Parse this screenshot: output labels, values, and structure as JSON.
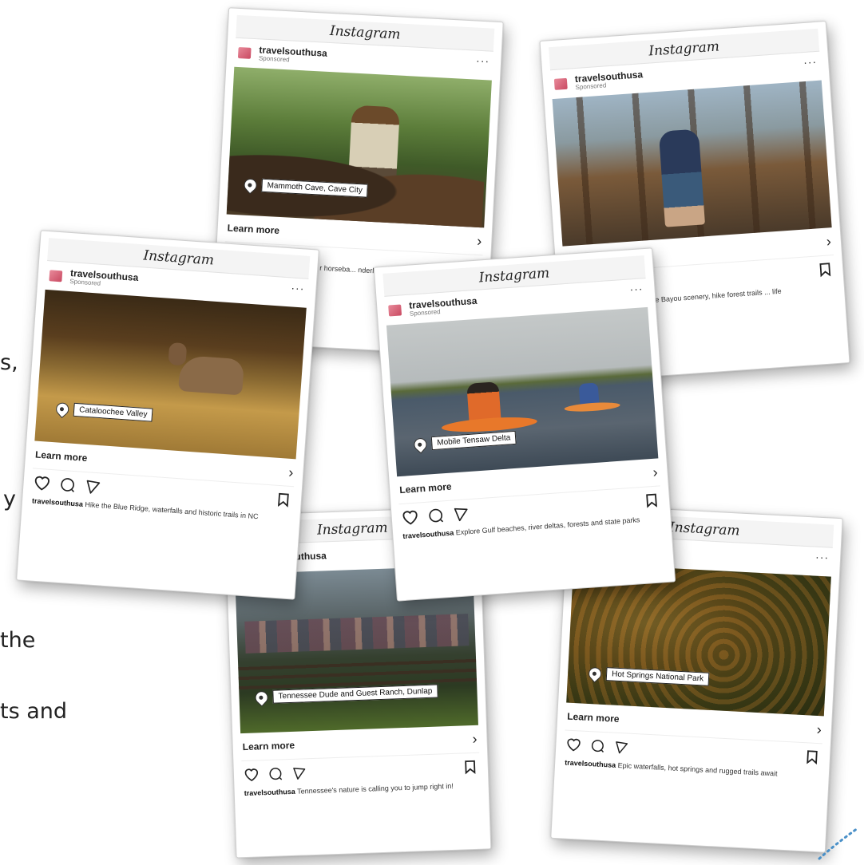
{
  "side_text": [
    "s,",
    "y",
    "the",
    "ts and"
  ],
  "brand": "Instagram",
  "account": {
    "handle": "travelsouthusa",
    "sponsored": "Sponsored"
  },
  "cta": {
    "learn_more": "Learn more"
  },
  "icons": {
    "more": "more-dots-icon",
    "pin": "location-pin-icon",
    "like": "heart-icon",
    "comment": "comment-icon",
    "share": "send-icon",
    "save": "bookmark-icon",
    "next": "chevron-right-icon"
  },
  "cards": [
    {
      "location": "Mammoth Cave, Cave City",
      "caption": ""
    },
    {
      "location": "",
      "caption": "Paddle Bayou scenery, hike forest trails ... life"
    },
    {
      "location": "Cataloochee Valley",
      "caption": "Hike the Blue Ridge, waterfalls and historic trails in NC"
    },
    {
      "location": "Mobile Tensaw Delta",
      "caption": "Explore Gulf beaches, river deltas, forests and state parks"
    },
    {
      "location": "Tennessee Dude and Guest Ranch, Dunlap",
      "caption": "Tennessee's nature is calling you to jump right in!"
    },
    {
      "location": "Hot Springs National Park",
      "caption": "Epic waterfalls, hot springs and rugged trails await"
    }
  ],
  "partial_caption_behind": "r horseba... nderland"
}
